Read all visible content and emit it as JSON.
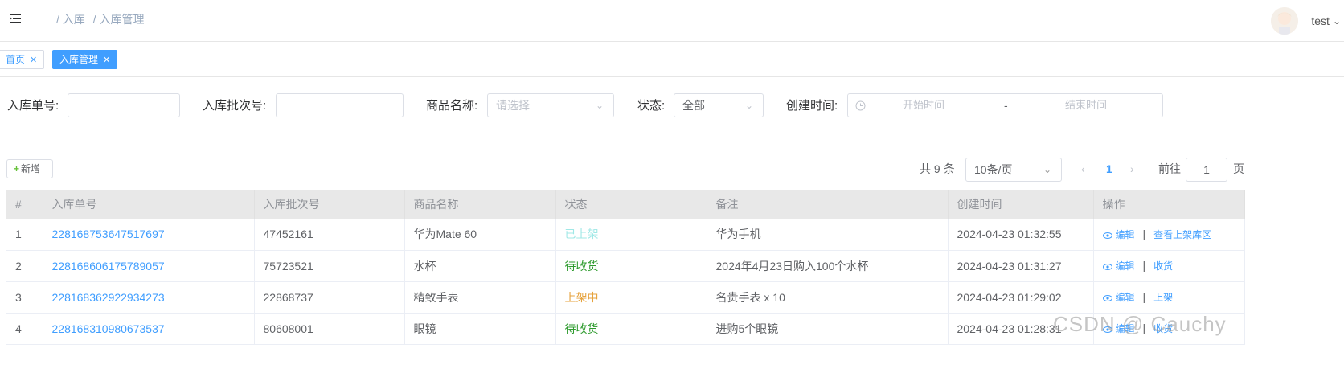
{
  "header": {
    "breadcrumb": [
      "/ 入库",
      "/ 入库管理"
    ],
    "username": "test"
  },
  "tags": [
    {
      "label": "首页"
    },
    {
      "label": "入库管理"
    }
  ],
  "filters": {
    "order_no_label": "入库单号:",
    "batch_no_label": "入库批次号:",
    "product_label": "商品名称:",
    "product_placeholder": "请选择",
    "status_label": "状态:",
    "status_value": "全部",
    "created_label": "创建时间:",
    "start_placeholder": "开始时间",
    "range_sep": "-",
    "end_placeholder": "结束时间"
  },
  "toolbar": {
    "add_label": "新增"
  },
  "pagination": {
    "total": "共 9 条",
    "page_size": "10条/页",
    "current": "1",
    "goto_label": "前往",
    "goto_value": "1",
    "page_suffix": "页"
  },
  "table": {
    "columns": [
      "#",
      "入库单号",
      "入库批次号",
      "商品名称",
      "状态",
      "备注",
      "创建时间",
      "操作"
    ],
    "rows": [
      {
        "idx": "1",
        "order_no": "228168753647517697",
        "batch_no": "47452161",
        "product": "华为Mate 60",
        "status": "已上架",
        "status_color": "#a0e8e6",
        "note": "华为手机",
        "created": "2024-04-23 01:32:55",
        "op_edit": "编辑",
        "op_extra": "查看上架库区"
      },
      {
        "idx": "2",
        "order_no": "228168606175789057",
        "batch_no": "75723521",
        "product": "水杯",
        "status": "待收货",
        "status_color": "#2e9b2e",
        "note": "2024年4月23日购入100个水杯",
        "created": "2024-04-23 01:31:27",
        "op_edit": "编辑",
        "op_extra": "收货"
      },
      {
        "idx": "3",
        "order_no": "228168362922934273",
        "batch_no": "22868737",
        "product": "精致手表",
        "status": "上架中",
        "status_color": "#e6a23c",
        "note": "名贵手表 x 10",
        "created": "2024-04-23 01:29:02",
        "op_edit": "编辑",
        "op_extra": "上架"
      },
      {
        "idx": "4",
        "order_no": "228168310980673537",
        "batch_no": "80608001",
        "product": "眼镜",
        "status": "待收货",
        "status_color": "#2e9b2e",
        "note": "进购5个眼镜",
        "created": "2024-04-23 01:28:31",
        "op_edit": "编辑",
        "op_extra": "收货"
      }
    ]
  },
  "watermark": "CSDN @ Cauchy"
}
